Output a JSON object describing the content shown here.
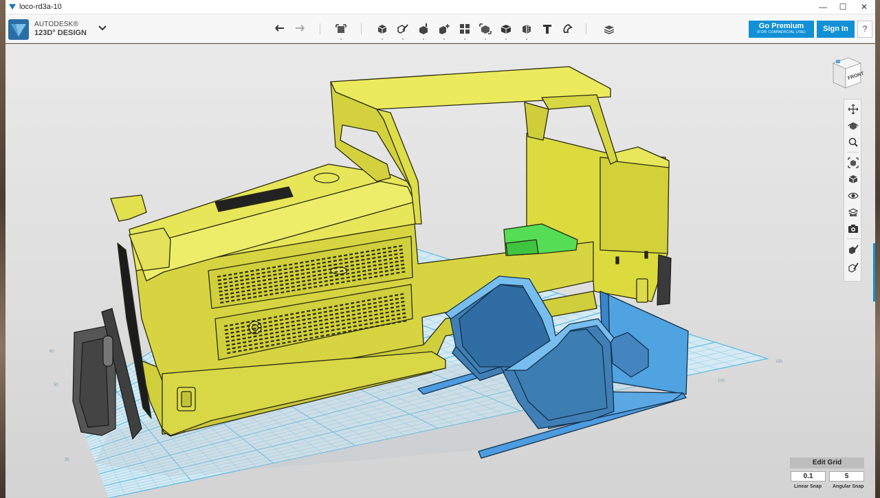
{
  "window": {
    "title": "loco-rd3a-10",
    "minimize": "—",
    "maximize": "☐",
    "close": "✕"
  },
  "app": {
    "brand_line1": "AUTODESK®",
    "brand_line2": "123D° DESIGN"
  },
  "toolbar": {
    "tools": [
      {
        "name": "undo-icon"
      },
      {
        "name": "redo-icon"
      },
      {
        "name": "transform-icon"
      },
      {
        "name": "primitives-icon"
      },
      {
        "name": "sketch-icon"
      },
      {
        "name": "construct-icon"
      },
      {
        "name": "modify-icon"
      },
      {
        "name": "pattern-icon"
      },
      {
        "name": "grouping-icon"
      },
      {
        "name": "combine-icon"
      },
      {
        "name": "measure-icon"
      },
      {
        "name": "text-icon"
      },
      {
        "name": "snap-icon"
      },
      {
        "name": "material-icon"
      }
    ],
    "premium_label": "Go Premium",
    "premium_sub": "(FOR COMMERCIAL USE)",
    "signin_label": "Sign In",
    "help_label": "?"
  },
  "viewcube": {
    "face_label": "FRONT"
  },
  "navbar": {
    "items": [
      {
        "name": "pan-icon"
      },
      {
        "name": "orbit-icon"
      },
      {
        "name": "zoom-icon"
      },
      {
        "name": "fit-icon"
      },
      {
        "name": "view-mode-icon"
      },
      {
        "name": "visibility-icon"
      },
      {
        "name": "materials-outline-icon"
      },
      {
        "name": "screenshot-icon"
      },
      {
        "name": "snap-tool-icon"
      },
      {
        "name": "analysis-icon"
      }
    ]
  },
  "grid": {
    "edit_label": "Edit Grid",
    "linear_snap_value": "0.1",
    "angular_snap_value": "5",
    "linear_snap_label": "Linear Snap",
    "angular_snap_label": "Angular Snap",
    "tick_labels": [
      "60",
      "50",
      "25",
      "100",
      "150"
    ]
  },
  "colors": {
    "accent": "#1190d6",
    "body_yellow": "#e3e24a",
    "part_blue": "#4a8fc8",
    "part_green": "#55dd55",
    "bumper_dark": "#555555",
    "grid_line": "#5bbde6"
  }
}
